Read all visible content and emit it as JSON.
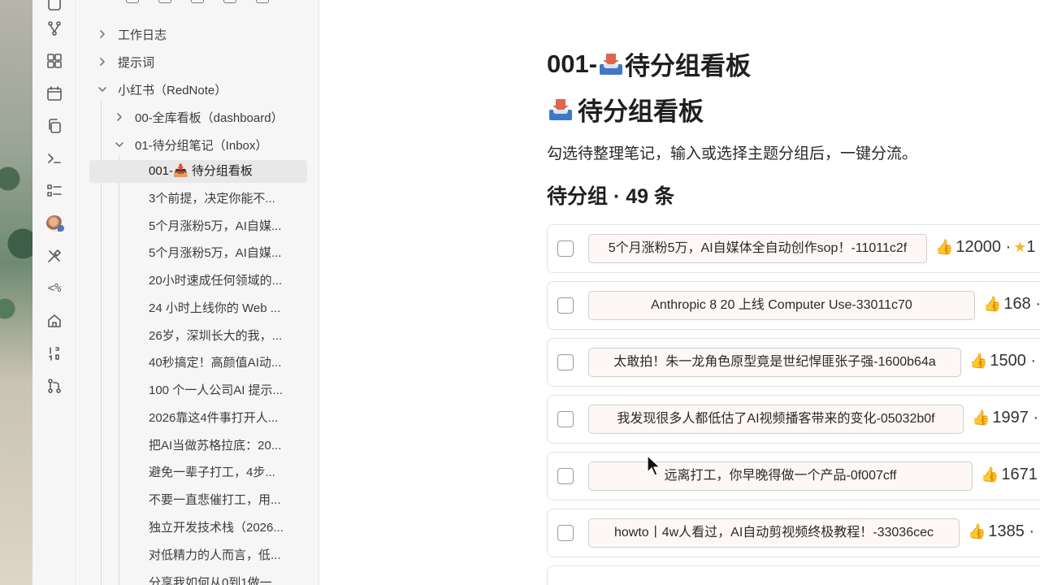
{
  "tree": {
    "folders": [
      {
        "label": "工作日志",
        "expanded": false
      },
      {
        "label": "提示词",
        "expanded": false
      },
      {
        "label": "小红书（RedNote）",
        "expanded": true
      },
      {
        "label": "00-全库看板（dashboard）",
        "expanded": false
      },
      {
        "label": "01-待分组笔记（Inbox）",
        "expanded": true
      }
    ],
    "files": [
      {
        "label": "001-📥 待分组看板",
        "active": true
      },
      {
        "label": "3个前提，决定你能不..."
      },
      {
        "label": "5个月涨粉5万，AI自媒..."
      },
      {
        "label": "5个月涨粉5万，AI自媒..."
      },
      {
        "label": "20小时速成任何领域的..."
      },
      {
        "label": "24 小时上线你的 Web ..."
      },
      {
        "label": "26岁，深圳长大的我，..."
      },
      {
        "label": "40秒搞定！高颜值AI动..."
      },
      {
        "label": "100 个一人公司AI 提示..."
      },
      {
        "label": "2026靠这4件事打开人..."
      },
      {
        "label": "把AI当做苏格拉底：20..."
      },
      {
        "label": "避免一辈子打工，4步..."
      },
      {
        "label": "不要一直悲催打工，用..."
      },
      {
        "label": "独立开发技术栈（2026..."
      },
      {
        "label": "对低精力的人而言，低..."
      },
      {
        "label": "分享我如何从0到1做一..."
      }
    ]
  },
  "rail": {
    "icons": [
      "graph-icon",
      "grid-icon",
      "calendar-icon",
      "copy-icon",
      "terminal-icon",
      "list-icon",
      "avatar-icon",
      "tools-icon",
      "template-icon",
      "home-icon",
      "number-icon",
      "git-icon"
    ],
    "template_text": "<%"
  },
  "main": {
    "h1_prefix": "001-",
    "h1_suffix": "待分组看板",
    "h2_text": "待分组看板",
    "description": "勾选待整理笔记，输入或选择主题分组后，一键分流。",
    "count_label": "待分组 · 49 条",
    "cards": [
      {
        "title": "5个月涨粉5万，AI自媒体全自动创作sop！-11011c2f",
        "stats": "12000 ·",
        "has_star": true,
        "star_text": "1"
      },
      {
        "title": "Anthropic 8 20 上线 Computer Use-33011c70",
        "stats": "168 ·",
        "has_star": false
      },
      {
        "title": "太敢拍！朱一龙角色原型竟是世纪悍匪张子强-1600b64a",
        "stats": "1500 ·",
        "has_star": false
      },
      {
        "title": "我发现很多人都低估了AI视频播客带来的变化-05032b0f",
        "stats": "1997 ·",
        "has_star": false
      },
      {
        "title": "远离打工，你早晚得做一个产品-0f007cff",
        "stats": "1671",
        "has_star": false
      },
      {
        "title": "howto丨4w人看过，AI自动剪视频终极教程！-33036cec",
        "stats": "1385 ·",
        "has_star": false
      }
    ]
  }
}
